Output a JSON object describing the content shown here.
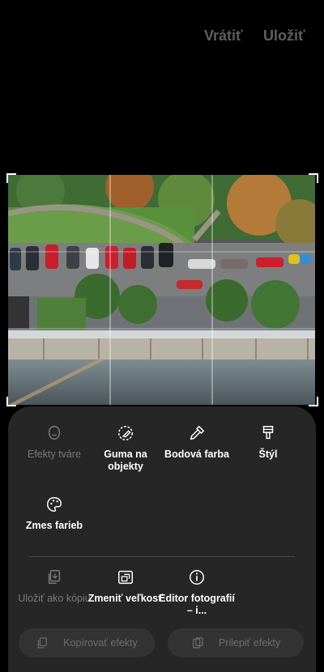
{
  "toolbar": {
    "revert_label": "Vrátiť",
    "save_label": "Uložiť"
  },
  "tools": {
    "face_effects": "Efekty tváre",
    "object_eraser": "Guma na objekty",
    "spot_color": "Bodová farba",
    "style": "Štýl",
    "color_mix": "Zmes farieb"
  },
  "actions": {
    "save_copy": "Uložiť ako kópiu",
    "resize": "Zmeniť veľkosť",
    "editor_info": "Editor fotografií – i..."
  },
  "buttons": {
    "copy_effects": "Kopírovať efekty",
    "paste_effects": "Prilepiť efekty"
  },
  "colors": {
    "accent_disabled": "#7a7a7a",
    "panel": "#262626",
    "background": "#000000"
  }
}
